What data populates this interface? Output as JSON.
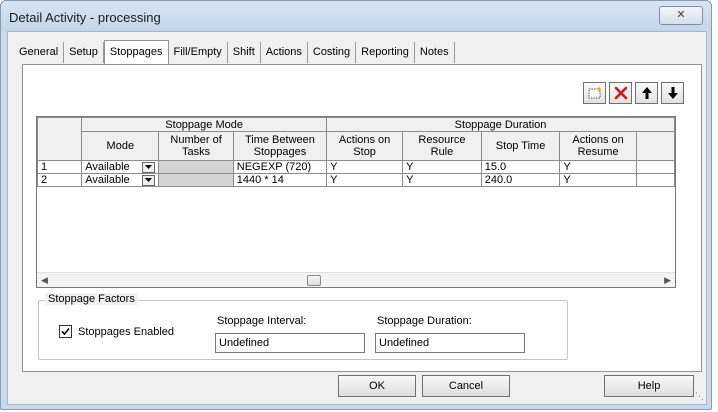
{
  "window": {
    "title": "Detail Activity - processing",
    "close_label": "✕"
  },
  "tabs": [
    {
      "label": "General",
      "active": false
    },
    {
      "label": "Setup",
      "active": false
    },
    {
      "label": "Stoppages",
      "active": true
    },
    {
      "label": "Fill/Empty",
      "active": false
    },
    {
      "label": "Shift",
      "active": false
    },
    {
      "label": "Actions",
      "active": false
    },
    {
      "label": "Costing",
      "active": false
    },
    {
      "label": "Reporting",
      "active": false
    },
    {
      "label": "Notes",
      "active": false
    }
  ],
  "toolbar": {
    "icons": [
      "new-row-icon",
      "delete-icon",
      "move-up-icon",
      "move-down-icon"
    ]
  },
  "grid": {
    "group_headers": {
      "mode_group": "Stoppage Mode",
      "duration_group": "Stoppage Duration"
    },
    "columns": [
      "Mode",
      "Number of Tasks",
      "Time Between Stoppages",
      "Actions on Stop",
      "Resource Rule",
      "Stop Time",
      "Actions on Resume"
    ],
    "rows": [
      {
        "num": "1",
        "mode": "Available",
        "tasks": "",
        "time_between": "NEGEXP (720)",
        "actions_stop": "Y",
        "resource_rule": "Y",
        "stop_time": "15.0",
        "actions_resume": "Y"
      },
      {
        "num": "2",
        "mode": "Available",
        "tasks": "",
        "time_between": "1440 * 14",
        "actions_stop": "Y",
        "resource_rule": "Y",
        "stop_time": "240.0",
        "actions_resume": "Y"
      }
    ]
  },
  "factors": {
    "legend": "Stoppage Factors",
    "enabled_label": "Stoppages Enabled",
    "enabled_checked": true,
    "interval_label": "Stoppage Interval:",
    "interval_value": "Undefined",
    "duration_label": "Stoppage Duration:",
    "duration_value": "Undefined"
  },
  "buttons": {
    "ok": "OK",
    "cancel": "Cancel",
    "help": "Help"
  }
}
